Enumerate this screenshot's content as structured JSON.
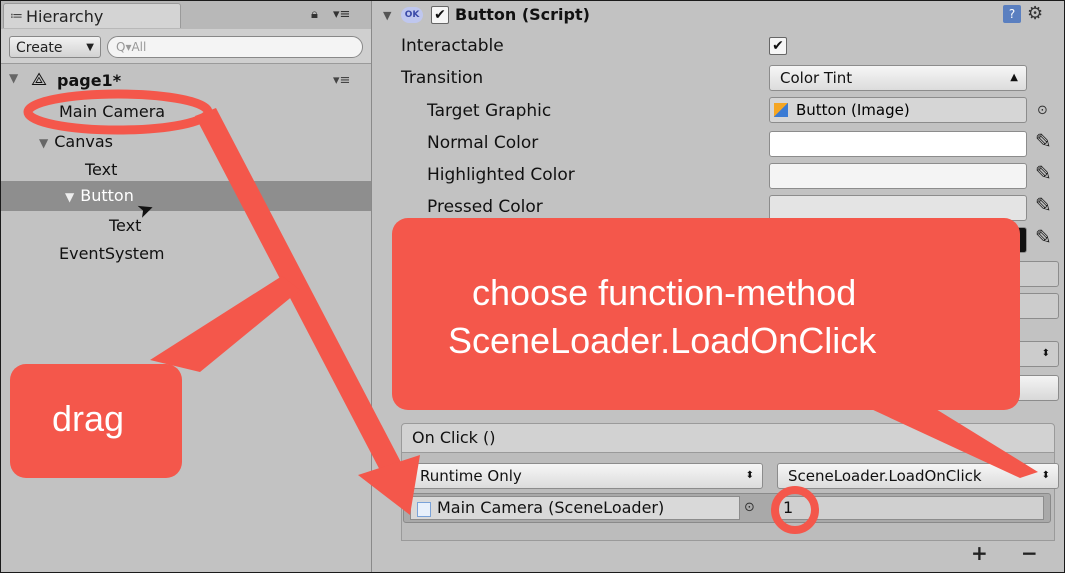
{
  "hierarchy": {
    "tab_label": "Hierarchy",
    "tab_icon": "≔",
    "create_label": "Create",
    "search_placeholder": "Q▾All",
    "scene_name": "page1*",
    "items": [
      {
        "label": "Main Camera",
        "depth": 1
      },
      {
        "label": "Canvas",
        "depth": 1,
        "expanded": true
      },
      {
        "label": "Text",
        "depth": 2
      },
      {
        "label": "Button",
        "depth": 2,
        "expanded": true,
        "selected": true
      },
      {
        "label": "Text",
        "depth": 3
      },
      {
        "label": "EventSystem",
        "depth": 1
      }
    ]
  },
  "inspector": {
    "component_title": "Button (Script)",
    "ok_badge": "OK",
    "properties": {
      "interactable_label": "Interactable",
      "interactable_checked": true,
      "transition_label": "Transition",
      "transition_value": "Color Tint",
      "target_graphic_label": "Target Graphic",
      "target_graphic_value": "Button (Image)",
      "normal_color_label": "Normal Color",
      "highlighted_color_label": "Highlighted Color",
      "pressed_color_label": "Pressed Color"
    },
    "on_click": {
      "header": "On Click ()",
      "runtime_value": "Runtime Only",
      "function_value": "SceneLoader.LoadOnClick",
      "object_value": "Main Camera (SceneLoader)",
      "argument_value": "1",
      "plus": "+",
      "minus": "−"
    }
  },
  "annotations": {
    "callout_function_line1": "choose function-method",
    "callout_function_line2": "SceneLoader.LoadOnClick",
    "callout_drag": "drag",
    "accent_color": "#f4574b"
  }
}
